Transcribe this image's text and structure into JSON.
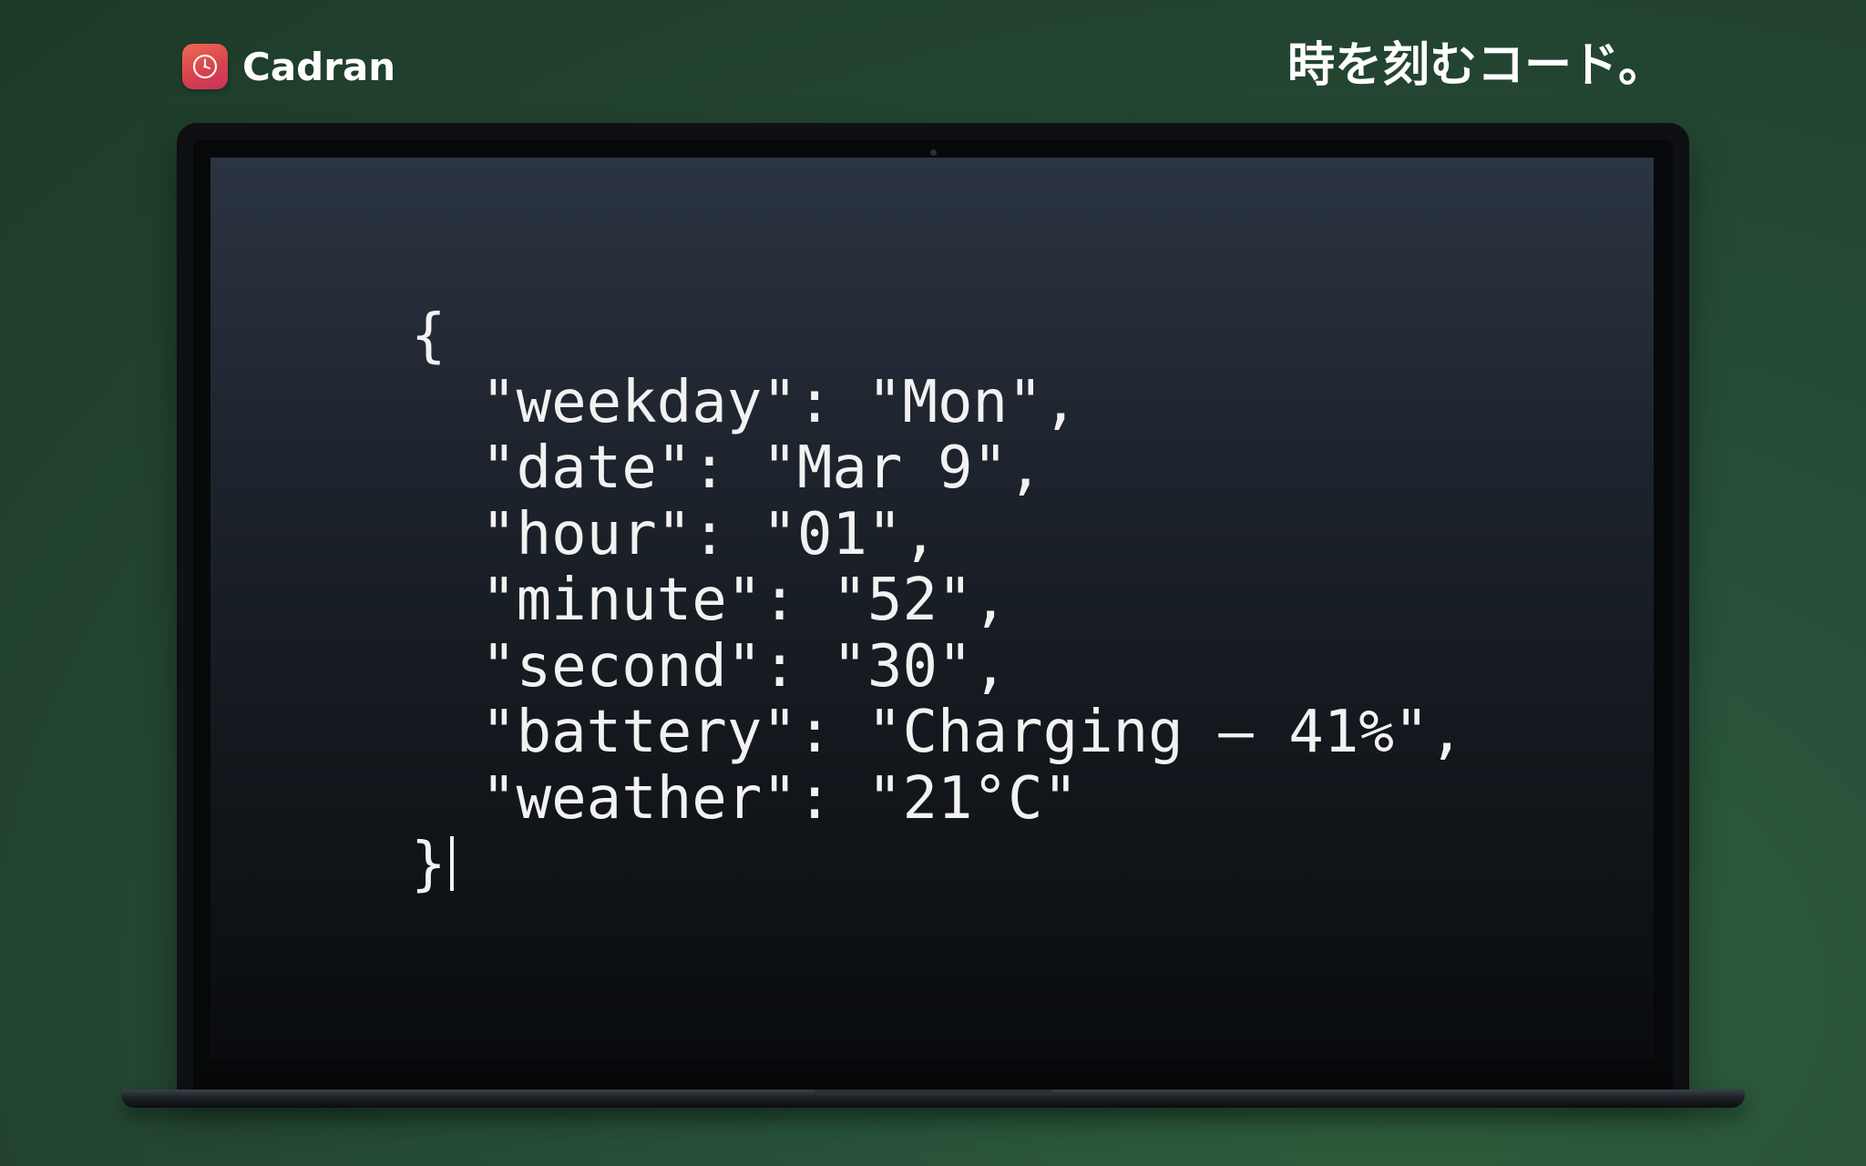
{
  "brand": {
    "app_name": "Cadran",
    "icon": "clock-icon",
    "icon_colors": [
      "#ec6a55",
      "#c8335d"
    ]
  },
  "tagline": "時を刻むコード。",
  "code": {
    "lines": [
      "{",
      "  \"weekday\": \"Mon\",",
      "  \"date\": \"Mar 9\",",
      "  \"hour\": \"01\",",
      "  \"minute\": \"52\",",
      "  \"second\": \"30\",",
      "  \"battery\": \"Charging – 41%\",",
      "  \"weather\": \"21°C\"",
      "}"
    ]
  },
  "colors": {
    "background": "#22432f",
    "text": "#f2f2f2",
    "screen_top": "#2b3442",
    "screen_bottom": "#0a0c0f"
  }
}
